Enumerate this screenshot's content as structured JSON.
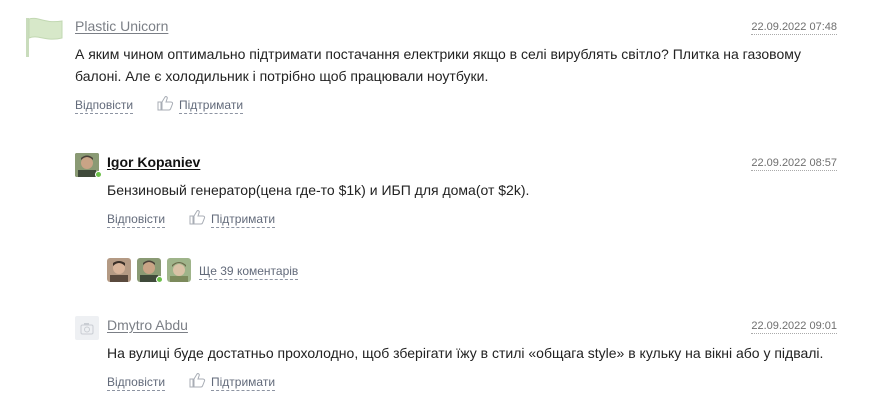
{
  "comments": [
    {
      "author": "Plastic Unicorn",
      "date": "22.09.2022 07:48",
      "text_line1": "А яким чином оптимально підтримати постачання електрики якщо в селі вирублять світло? Плитка на газовому",
      "text_line2": "балоні. Але є холодильник і потрібно щоб працювали ноутбуки.",
      "reply_label": "Відповісти",
      "support_label": "Підтримати",
      "avatar_icon": "flag-icon",
      "avatar_color": "#d7e8c9"
    },
    {
      "author": "Igor Kopaniev",
      "date": "22.09.2022 08:57",
      "text_line1": "Бензиновый генератор(цена где-то $1k) и ИБП для дома(от $2k).",
      "reply_label": "Відповісти",
      "support_label": "Підтримати",
      "more_comments_label": "Ще 39 коментарів"
    },
    {
      "author": "Dmytro Abdu",
      "date": "22.09.2022 09:01",
      "text_line1": "На вулиці буде достатньо прохолодно, щоб зберігати їжу в стилі «общага style» в кульку на вікні або у підвалі.",
      "reply_label": "Відповісти",
      "support_label": "Підтримати",
      "avatar_icon": "camera-icon"
    }
  ],
  "colors": {
    "link": "#626a7a",
    "online": "#6cc04a"
  }
}
